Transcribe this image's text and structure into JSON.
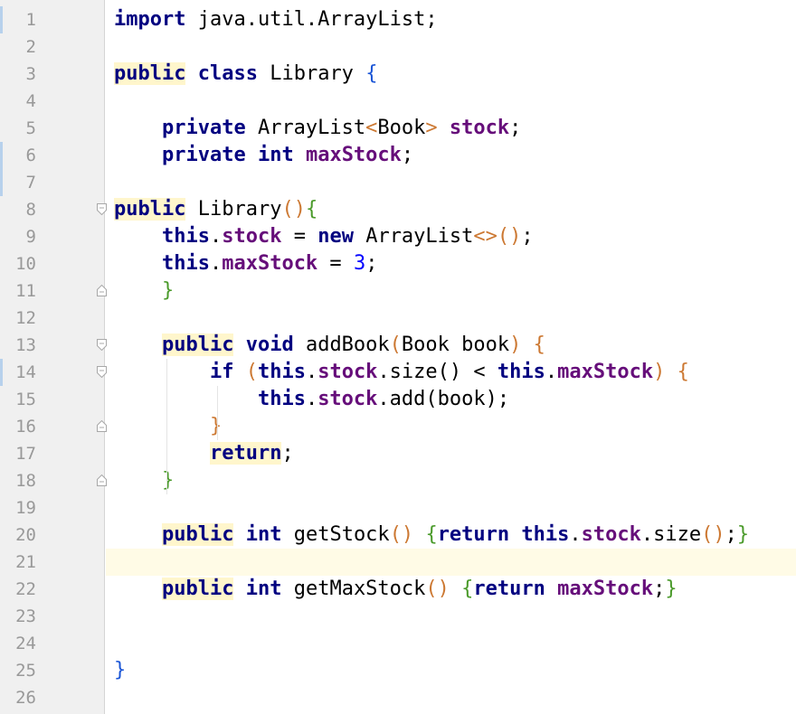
{
  "editor": {
    "language": "java",
    "colors": {
      "keyword": "#000080",
      "field": "#660e7a",
      "number": "#0000ff",
      "bracket_orange": "#cc7832",
      "bracket_green": "#4a9a2a",
      "bracket_blue": "#1a55d6",
      "gutter_bg": "#f0f0f0",
      "line_number": "#999999",
      "current_line": "#fffbe6"
    },
    "current_line": 21,
    "lines": [
      {
        "n": "1",
        "tokens": [
          [
            "kw",
            "import"
          ],
          [
            "t",
            " java.util.ArrayList;"
          ]
        ]
      },
      {
        "n": "2",
        "tokens": []
      },
      {
        "n": "3",
        "tokens": [
          [
            "kwh",
            "public"
          ],
          [
            "t",
            " "
          ],
          [
            "kw",
            "class"
          ],
          [
            "t",
            " Library "
          ],
          [
            "b3",
            "{"
          ]
        ]
      },
      {
        "n": "4",
        "tokens": []
      },
      {
        "n": "5",
        "tokens": [
          [
            "t",
            "    "
          ],
          [
            "kw",
            "private"
          ],
          [
            "t",
            " ArrayList"
          ],
          [
            "b1",
            "<"
          ],
          [
            "t",
            "Book"
          ],
          [
            "b1",
            ">"
          ],
          [
            "t",
            " "
          ],
          [
            "f",
            "stock"
          ],
          [
            "t",
            ";"
          ]
        ]
      },
      {
        "n": "6",
        "tokens": [
          [
            "t",
            "    "
          ],
          [
            "kw",
            "private"
          ],
          [
            "t",
            " "
          ],
          [
            "kw",
            "int"
          ],
          [
            "t",
            " "
          ],
          [
            "f",
            "maxStock"
          ],
          [
            "t",
            ";"
          ]
        ]
      },
      {
        "n": "7",
        "tokens": []
      },
      {
        "n": "8",
        "tokens": [
          [
            "kwh",
            "public"
          ],
          [
            "t",
            " Library"
          ],
          [
            "b1",
            "()"
          ],
          [
            "b2",
            "{"
          ]
        ]
      },
      {
        "n": "9",
        "tokens": [
          [
            "t",
            "    "
          ],
          [
            "kw",
            "this"
          ],
          [
            "t",
            "."
          ],
          [
            "f",
            "stock"
          ],
          [
            "t",
            " = "
          ],
          [
            "kw",
            "new"
          ],
          [
            "t",
            " ArrayList"
          ],
          [
            "b1",
            "<>"
          ],
          [
            "b1",
            "()"
          ],
          [
            "t",
            ";"
          ]
        ]
      },
      {
        "n": "10",
        "tokens": [
          [
            "t",
            "    "
          ],
          [
            "kw",
            "this"
          ],
          [
            "t",
            "."
          ],
          [
            "f",
            "maxStock"
          ],
          [
            "t",
            " = "
          ],
          [
            "num",
            "3"
          ],
          [
            "t",
            ";"
          ]
        ]
      },
      {
        "n": "11",
        "tokens": [
          [
            "t",
            "    "
          ],
          [
            "b2",
            "}"
          ]
        ]
      },
      {
        "n": "12",
        "tokens": []
      },
      {
        "n": "13",
        "tokens": [
          [
            "t",
            "    "
          ],
          [
            "kwh",
            "public"
          ],
          [
            "t",
            " "
          ],
          [
            "kw",
            "void"
          ],
          [
            "t",
            " addBook"
          ],
          [
            "b1",
            "("
          ],
          [
            "t",
            "Book book"
          ],
          [
            "b1",
            ")"
          ],
          [
            "t",
            " "
          ],
          [
            "b1",
            "{"
          ]
        ]
      },
      {
        "n": "14",
        "tokens": [
          [
            "t",
            "        "
          ],
          [
            "kw",
            "if"
          ],
          [
            "t",
            " "
          ],
          [
            "b1",
            "("
          ],
          [
            "kw",
            "this"
          ],
          [
            "t",
            "."
          ],
          [
            "f",
            "stock"
          ],
          [
            "t",
            ".size() < "
          ],
          [
            "kw",
            "this"
          ],
          [
            "t",
            "."
          ],
          [
            "f",
            "maxStock"
          ],
          [
            "b1",
            ")"
          ],
          [
            "t",
            " "
          ],
          [
            "b1",
            "{"
          ]
        ]
      },
      {
        "n": "15",
        "tokens": [
          [
            "t",
            "            "
          ],
          [
            "kw",
            "this"
          ],
          [
            "t",
            "."
          ],
          [
            "f",
            "stock"
          ],
          [
            "t",
            ".add"
          ],
          [
            "b4",
            "("
          ],
          [
            "t",
            "book"
          ],
          [
            "b4",
            ")"
          ],
          [
            "t",
            ";"
          ]
        ]
      },
      {
        "n": "16",
        "tokens": [
          [
            "t",
            "        "
          ],
          [
            "b1",
            "}"
          ]
        ]
      },
      {
        "n": "17",
        "tokens": [
          [
            "t",
            "        "
          ],
          [
            "kwh",
            "return"
          ],
          [
            "t",
            ";"
          ]
        ]
      },
      {
        "n": "18",
        "tokens": [
          [
            "t",
            "    "
          ],
          [
            "b2",
            "}"
          ]
        ]
      },
      {
        "n": "19",
        "tokens": []
      },
      {
        "n": "20",
        "tokens": [
          [
            "t",
            "    "
          ],
          [
            "kwh",
            "public"
          ],
          [
            "t",
            " "
          ],
          [
            "kw",
            "int"
          ],
          [
            "t",
            " getStock"
          ],
          [
            "b1",
            "()"
          ],
          [
            "t",
            " "
          ],
          [
            "b2",
            "{"
          ],
          [
            "kw",
            "return"
          ],
          [
            "t",
            " "
          ],
          [
            "kw",
            "this"
          ],
          [
            "t",
            "."
          ],
          [
            "f",
            "stock"
          ],
          [
            "t",
            ".size"
          ],
          [
            "b1",
            "()"
          ],
          [
            "t",
            ";"
          ],
          [
            "b2",
            "}"
          ]
        ]
      },
      {
        "n": "21",
        "tokens": []
      },
      {
        "n": "22",
        "tokens": [
          [
            "t",
            "    "
          ],
          [
            "kwh",
            "public"
          ],
          [
            "t",
            " "
          ],
          [
            "kw",
            "int"
          ],
          [
            "t",
            " getMaxStock"
          ],
          [
            "b1",
            "()"
          ],
          [
            "t",
            " "
          ],
          [
            "b2",
            "{"
          ],
          [
            "kw",
            "return"
          ],
          [
            "t",
            " "
          ],
          [
            "f",
            "maxStock"
          ],
          [
            "t",
            ";"
          ],
          [
            "b2",
            "}"
          ]
        ]
      },
      {
        "n": "23",
        "tokens": []
      },
      {
        "n": "24",
        "tokens": []
      },
      {
        "n": "25",
        "tokens": [
          [
            "b3",
            "}"
          ]
        ]
      },
      {
        "n": "26",
        "tokens": []
      }
    ]
  }
}
